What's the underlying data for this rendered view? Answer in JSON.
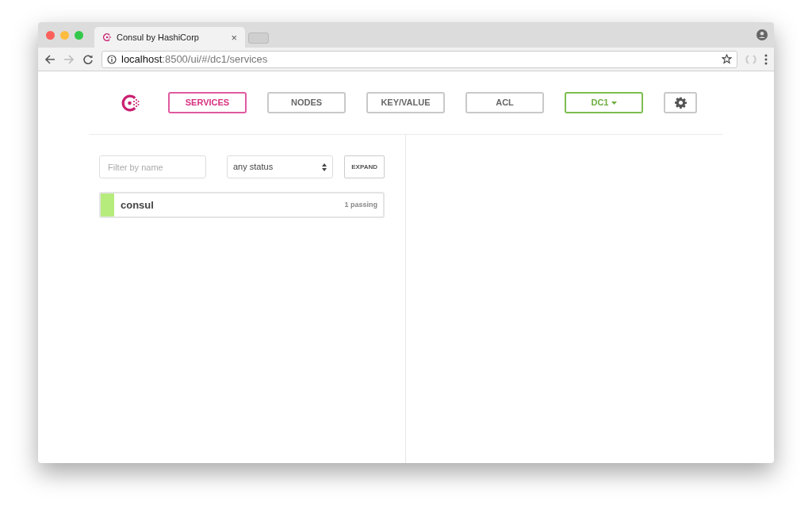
{
  "browser": {
    "tab": {
      "title": "Consul by HashiCorp",
      "close": "×"
    },
    "url_host": "localhost",
    "url_path": ":8500/ui/#/dc1/services"
  },
  "nav": [
    {
      "kind": "button",
      "label": "SERVICES",
      "selected": true
    },
    {
      "kind": "button",
      "label": "NODES",
      "selected": false
    },
    {
      "kind": "button",
      "label": "KEY/VALUE",
      "selected": false
    },
    {
      "kind": "button",
      "label": "ACL",
      "selected": false
    },
    {
      "kind": "dropdown",
      "label": "DC1",
      "selected": false
    },
    {
      "kind": "settings",
      "selected": false
    }
  ],
  "filter": {
    "placeholder": "Filter by name",
    "status": "any status",
    "expand": "EXPAND"
  },
  "services": [
    {
      "name": "consul",
      "status": "1 passing",
      "color": "#b6ec7c"
    }
  ]
}
